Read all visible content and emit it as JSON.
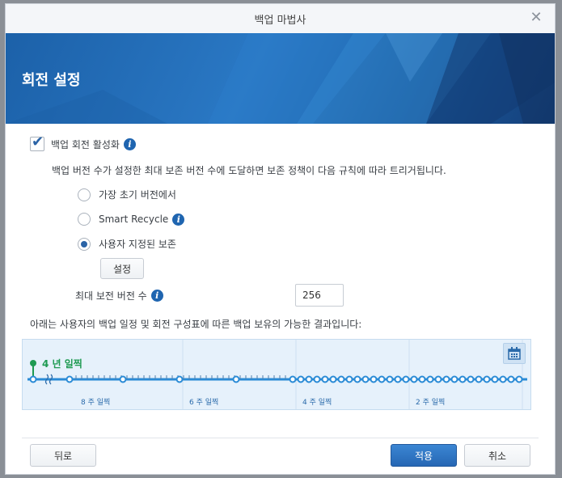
{
  "window": {
    "title": "백업 마법사",
    "close_glyph": "✕"
  },
  "banner": {
    "title": "회전 설정"
  },
  "rotation": {
    "enable_label": "백업 회전 활성화",
    "enabled": true,
    "info_glyph": "i",
    "description": "백업 버전 수가 설정한 최대 보존 버전 수에 도달하면 보존 정책이 다음 규칙에 따라 트리거됩니다.",
    "options": [
      {
        "label": "가장 초기 버전에서",
        "selected": false
      },
      {
        "label": "Smart Recycle",
        "selected": false,
        "has_info": true
      },
      {
        "label": "사용자 지정된 보존",
        "selected": true
      }
    ],
    "settings_button": "설정",
    "max_versions_label": "최대 보전 버전 수",
    "max_versions_value": "256"
  },
  "timeline": {
    "caption": "아래는 사용자의 백업 일정 및 회전 구성표에 따른 백업 보유의 가능한 결과입니다:",
    "marker_label": "4 년 일찍",
    "week_labels": [
      "8 주 일찍",
      "6 주 일찍",
      "4 주 일찍",
      "2 주 일찍"
    ],
    "calendar_icon": "calendar-icon",
    "colors": {
      "accent": "#2a8bd6",
      "marker": "#1e9a52",
      "background": "#e6f1fb"
    }
  },
  "footer": {
    "back": "뒤로",
    "apply": "적용",
    "cancel": "취소"
  }
}
